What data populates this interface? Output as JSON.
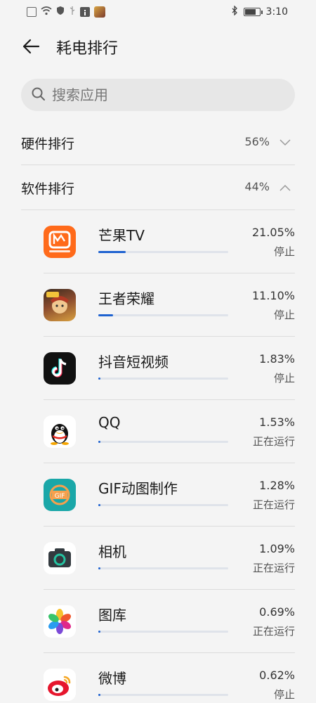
{
  "status_bar": {
    "time": "3:10",
    "battery_level": 0.7
  },
  "header": {
    "title": "耗电排行"
  },
  "search": {
    "placeholder": "搜索应用"
  },
  "sections": [
    {
      "label": "硬件排行",
      "percent": "56%",
      "chevron": "chevron-down"
    },
    {
      "label": "软件排行",
      "percent": "44%",
      "chevron": "chevron-up"
    }
  ],
  "apps": [
    {
      "name": "芒果TV",
      "percent": "21.05%",
      "status": "停止",
      "usage": 21.05,
      "icon": "mango-tv-icon"
    },
    {
      "name": "王者荣耀",
      "percent": "11.10%",
      "status": "停止",
      "usage": 11.1,
      "icon": "honor-of-kings-icon"
    },
    {
      "name": "抖音短视频",
      "percent": "1.83%",
      "status": "停止",
      "usage": 1.83,
      "icon": "douyin-icon"
    },
    {
      "name": "QQ",
      "percent": "1.53%",
      "status": "正在运行",
      "usage": 1.53,
      "icon": "qq-icon"
    },
    {
      "name": "GIF动图制作",
      "percent": "1.28%",
      "status": "正在运行",
      "usage": 1.28,
      "icon": "gif-maker-icon"
    },
    {
      "name": "相机",
      "percent": "1.09%",
      "status": "正在运行",
      "usage": 1.09,
      "icon": "camera-icon"
    },
    {
      "name": "图库",
      "percent": "0.69%",
      "status": "正在运行",
      "usage": 0.69,
      "icon": "gallery-icon"
    },
    {
      "name": "微博",
      "percent": "0.62%",
      "status": "停止",
      "usage": 0.62,
      "icon": "weibo-icon"
    }
  ],
  "colors": {
    "accent": "#1e62d0",
    "background": "#f4f4f4",
    "divider": "#dcdcdc"
  }
}
